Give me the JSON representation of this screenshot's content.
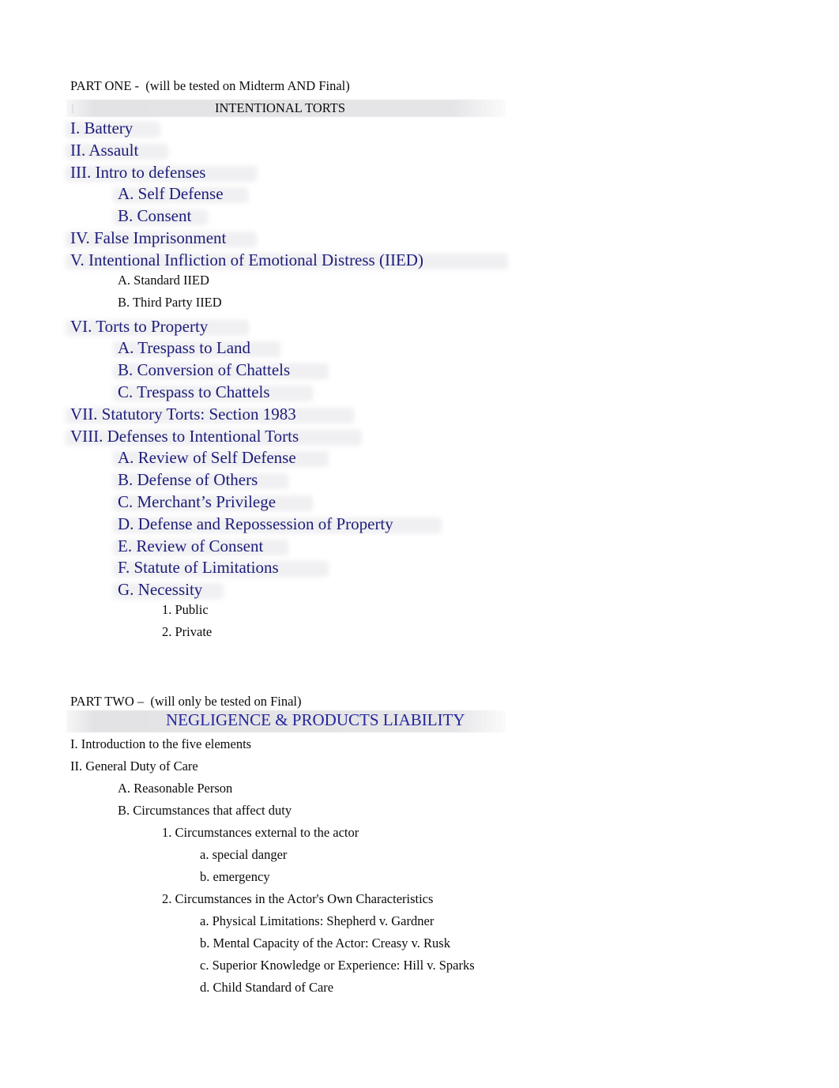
{
  "document": {
    "title": "Torts Course Outline",
    "page_background": "#ffffff",
    "colors": {
      "body_text": "#0b0b0b",
      "heading_blue": "#1d1d7a",
      "banner_blue": "#25259a",
      "band_grey": "#e4e4e7"
    }
  },
  "part_one": {
    "label": "PART ONE -  (will be tested on Midterm AND Final)",
    "banner": "INTENTIONAL TORTS",
    "items": [
      {
        "text": "I. Battery",
        "level": 0,
        "style": "blue"
      },
      {
        "text": "II. Assault",
        "level": 0,
        "style": "blue"
      },
      {
        "text": "III. Intro to defenses",
        "level": 0,
        "style": "blue"
      },
      {
        "text": "A. Self Defense",
        "level": 1,
        "style": "blue"
      },
      {
        "text": "B. Consent",
        "level": 1,
        "style": "blue"
      },
      {
        "text": "IV. False Imprisonment",
        "level": 0,
        "style": "blue"
      },
      {
        "text": "V. Intentional Infliction of Emotional Distress (IIED)",
        "level": 0,
        "style": "blue"
      },
      {
        "text": "A. Standard IIED",
        "level": 1,
        "style": "black"
      },
      {
        "text": "B. Third Party IIED",
        "level": 1,
        "style": "black"
      },
      {
        "text": "VI. Torts to Property",
        "level": 0,
        "style": "blue"
      },
      {
        "text": "A. Trespass to Land",
        "level": 1,
        "style": "blue"
      },
      {
        "text": "B. Conversion of Chattels",
        "level": 1,
        "style": "blue"
      },
      {
        "text": "C. Trespass to Chattels",
        "level": 1,
        "style": "blue"
      },
      {
        "text": "VII. Statutory Torts: Section 1983",
        "level": 0,
        "style": "blue"
      },
      {
        "text": "VIII. Defenses to Intentional Torts",
        "level": 0,
        "style": "blue"
      },
      {
        "text": "A. Review of Self Defense",
        "level": 1,
        "style": "blue"
      },
      {
        "text": "B. Defense of Others",
        "level": 1,
        "style": "blue"
      },
      {
        "text": "C. Merchant’s Privilege",
        "level": 1,
        "style": "blue"
      },
      {
        "text": "D. Defense and Repossession of Property",
        "level": 1,
        "style": "blue"
      },
      {
        "text": "E. Review of Consent",
        "level": 1,
        "style": "blue"
      },
      {
        "text": "F. Statute of Limitations",
        "level": 1,
        "style": "blue"
      },
      {
        "text": "G. Necessity",
        "level": 1,
        "style": "blue"
      },
      {
        "text": "1. Public",
        "level": 2,
        "style": "black"
      },
      {
        "text": "2. Private",
        "level": 2,
        "style": "black"
      }
    ]
  },
  "part_two": {
    "label": "PART TWO –  (will only be tested on Final)",
    "banner": "NEGLIGENCE & PRODUCTS LIABILITY",
    "items": [
      {
        "text": "I. Introduction to the five elements",
        "level": 0,
        "style": "black"
      },
      {
        "text": "II. General Duty of Care",
        "level": 0,
        "style": "black"
      },
      {
        "text": "A. Reasonable Person",
        "level": 1,
        "style": "black"
      },
      {
        "text": "B. Circumstances that affect duty",
        "level": 1,
        "style": "black"
      },
      {
        "text": "1. Circumstances external to the actor",
        "level": 2,
        "style": "black"
      },
      {
        "text": "a. special danger",
        "level": 3,
        "style": "black"
      },
      {
        "text": "b. emergency",
        "level": 3,
        "style": "black"
      },
      {
        "text": "2. Circumstances in the Actor's Own Characteristics",
        "level": 2,
        "style": "black"
      },
      {
        "text": "a. Physical Limitations: Shepherd v. Gardner",
        "level": 3,
        "style": "black"
      },
      {
        "text": "b. Mental Capacity of the Actor: Creasy v. Rusk",
        "level": 3,
        "style": "black"
      },
      {
        "text": "c. Superior Knowledge or Experience: Hill v. Sparks",
        "level": 3,
        "style": "black"
      },
      {
        "text": "d. Child Standard of Care",
        "level": 3,
        "style": "black"
      }
    ]
  }
}
